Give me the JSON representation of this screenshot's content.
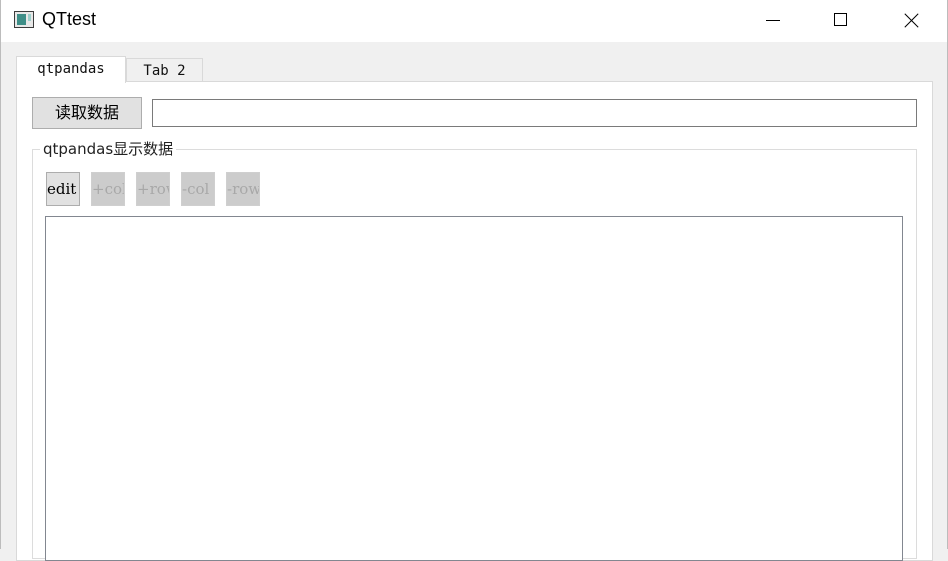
{
  "window": {
    "title": "QTtest"
  },
  "tabs": [
    {
      "label": "qtpandas",
      "active": true
    },
    {
      "label": "Tab 2",
      "active": false
    }
  ],
  "read_button_label": "读取数据",
  "path_input": {
    "value": "",
    "placeholder": ""
  },
  "group": {
    "title": "qtpandas显示数据",
    "tools": [
      {
        "label": "edit",
        "enabled": true
      },
      {
        "label": "+col",
        "enabled": false
      },
      {
        "label": "+row",
        "enabled": false
      },
      {
        "label": "-col",
        "enabled": false
      },
      {
        "label": "-row",
        "enabled": false
      }
    ]
  }
}
